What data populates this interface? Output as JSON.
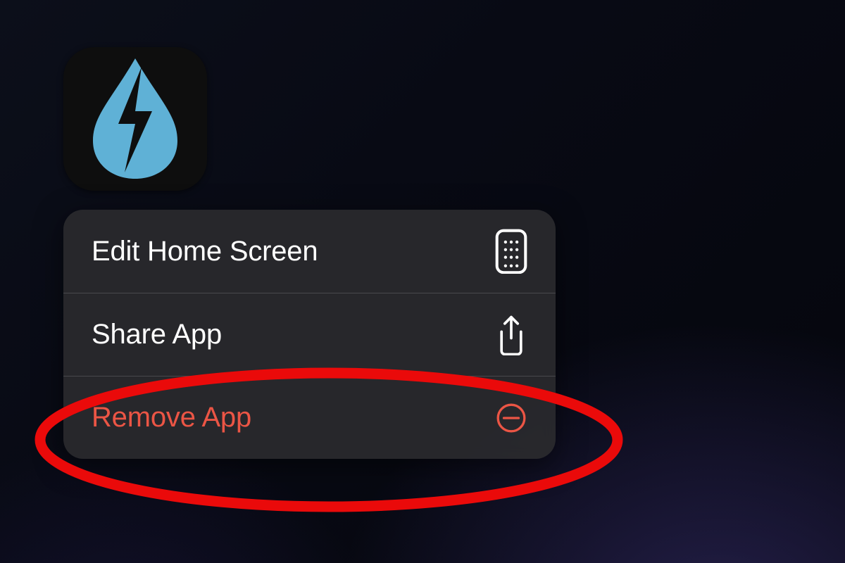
{
  "app_icon": {
    "name": "dark-sky-app-icon",
    "glyph": "water-drop-lightning"
  },
  "menu": {
    "items": [
      {
        "label": "Edit Home Screen",
        "icon": "apps-grid-icon",
        "destructive": false
      },
      {
        "label": "Share App",
        "icon": "share-icon",
        "destructive": false
      },
      {
        "label": "Remove App",
        "icon": "minus-circle-icon",
        "destructive": true
      }
    ]
  },
  "annotation": {
    "target_item_index": 2,
    "color": "#ea0a0a"
  }
}
